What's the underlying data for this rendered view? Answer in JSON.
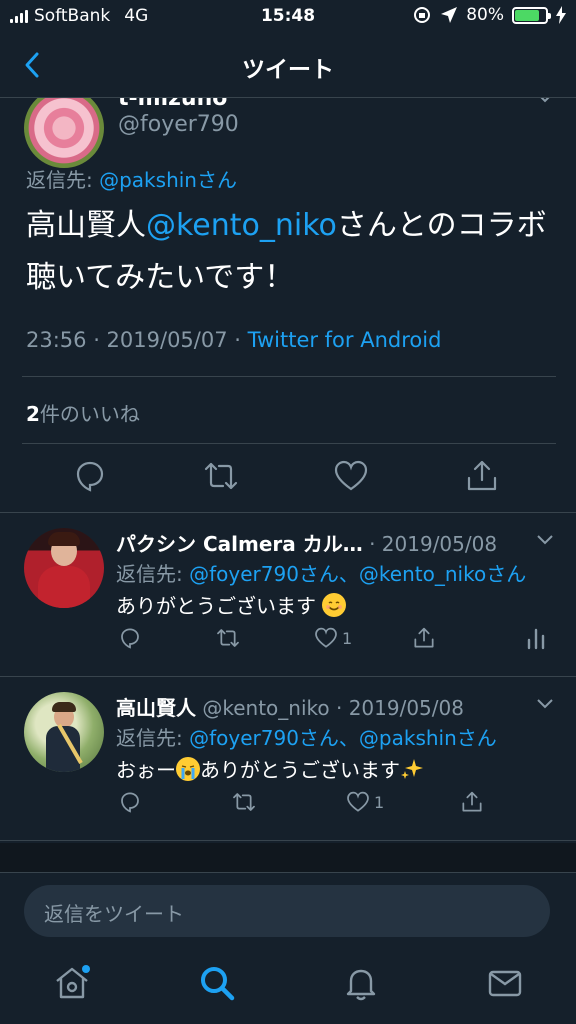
{
  "status_bar": {
    "carrier": "SoftBank",
    "network": "4G",
    "time": "15:48",
    "battery_percent": "80%",
    "battery_level": 0.8
  },
  "header": {
    "title": "ツイート"
  },
  "focal_tweet": {
    "author_name": "t-mizuho",
    "author_handle": "@foyer790",
    "reply_to_label": "返信先: ",
    "reply_to_user": "@pakshinさん",
    "body_before": "高山賢人",
    "body_mention": "@kento_niko",
    "body_after": "さんとのコラボ聴いてみたいです！",
    "time_date": "23:56 · 2019/05/07 · ",
    "client": "Twitter for Android",
    "like_count": "2",
    "like_label": "件のいいね"
  },
  "replies": [
    {
      "author_name": "パクシン Calmera カル…",
      "date": " · 2019/05/08",
      "reply_to_label": "返信先: ",
      "reply_to_users": "@foyer790さん、@kento_nikoさん",
      "text": "ありがとうございます",
      "emoji": "smiling-face",
      "like_count": "1"
    },
    {
      "author_name": "高山賢人",
      "author_handle": " @kento_niko",
      "date": " · 2019/05/08",
      "reply_to_label": "返信先: ",
      "reply_to_users": "@foyer790さん、@pakshinさん",
      "text_before": "おぉー",
      "text_after": "ありがとうございます",
      "like_count": "1"
    }
  ],
  "compose": {
    "placeholder": "返信をツイート"
  },
  "colors": {
    "background": "#15202b",
    "accent": "#1da1f2",
    "muted": "#8899a6",
    "divider": "#38444d"
  }
}
